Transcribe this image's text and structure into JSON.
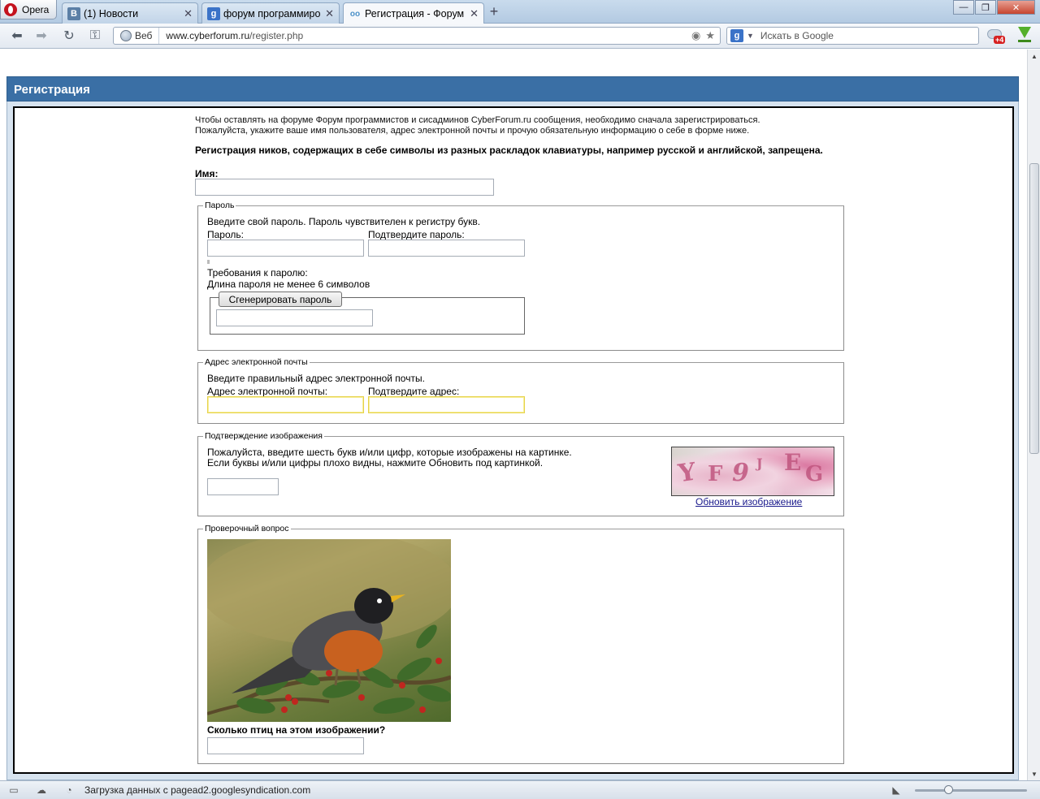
{
  "browser": {
    "menu_label": "Opera",
    "tabs": [
      {
        "label": "(1) Новости",
        "favicon": "В",
        "favicon_color": "#5b7fa6"
      },
      {
        "label": "форум программиро...",
        "favicon": "g",
        "favicon_color": "#3b73c8"
      },
      {
        "label": "Регистрация - Форум ...",
        "favicon": "oo",
        "favicon_color": "#4a90c8"
      }
    ],
    "address_badge": "Веб",
    "url_host": "www.cyberforum.ru",
    "url_path": "/register.php",
    "search_placeholder": "Искать в Google",
    "search_engine_icon": "g",
    "sync_badge": "+4"
  },
  "page": {
    "panel_title": "Регистрация",
    "intro_line1": "Чтобы оставлять на форуме Форум программистов и сисадминов CyberForum.ru сообщения, необходимо сначала зарегистрироваться.",
    "intro_line2": "Пожалуйста, укажите ваше имя пользователя, адрес электронной почты и прочую обязательную информацию о себе в форме ниже.",
    "warning": "Регистрация ников, содержащих в себе символы из разных раскладок клавиатуры, например русской и английской, запрещена.",
    "name_label": "Имя:",
    "password": {
      "legend": "Пароль",
      "description": "Введите свой пароль. Пароль чувствителен к регистру букв.",
      "password_label": "Пароль:",
      "confirm_label": "Подтвердите пароль:",
      "requirements_title": "Требования к паролю:",
      "requirements_text": "Длина пароля не менее 6 символов",
      "generate_button": "Сгенерировать пароль"
    },
    "email": {
      "legend": "Адрес электронной почты",
      "description": "Введите правильный адрес электронной почты.",
      "email_label": "Адрес электронной почты:",
      "confirm_label": "Подтвердите адрес:"
    },
    "captcha": {
      "legend": "Подтверждение изображения",
      "line1": "Пожалуйста, введите шесть букв и/или цифр, которые изображены на картинке.",
      "line2": "Если буквы и/или цифры плохо видны, нажмите Обновить под картинкой.",
      "refresh_link": "Обновить изображение",
      "chars": [
        "Y",
        "F",
        "9",
        "J",
        "E",
        "G"
      ]
    },
    "question": {
      "legend": "Проверочный вопрос",
      "text": "Сколько птиц на этом изображении?"
    }
  },
  "statusbar": {
    "message": "Загрузка данных с pagead2.googlesyndication.com"
  }
}
